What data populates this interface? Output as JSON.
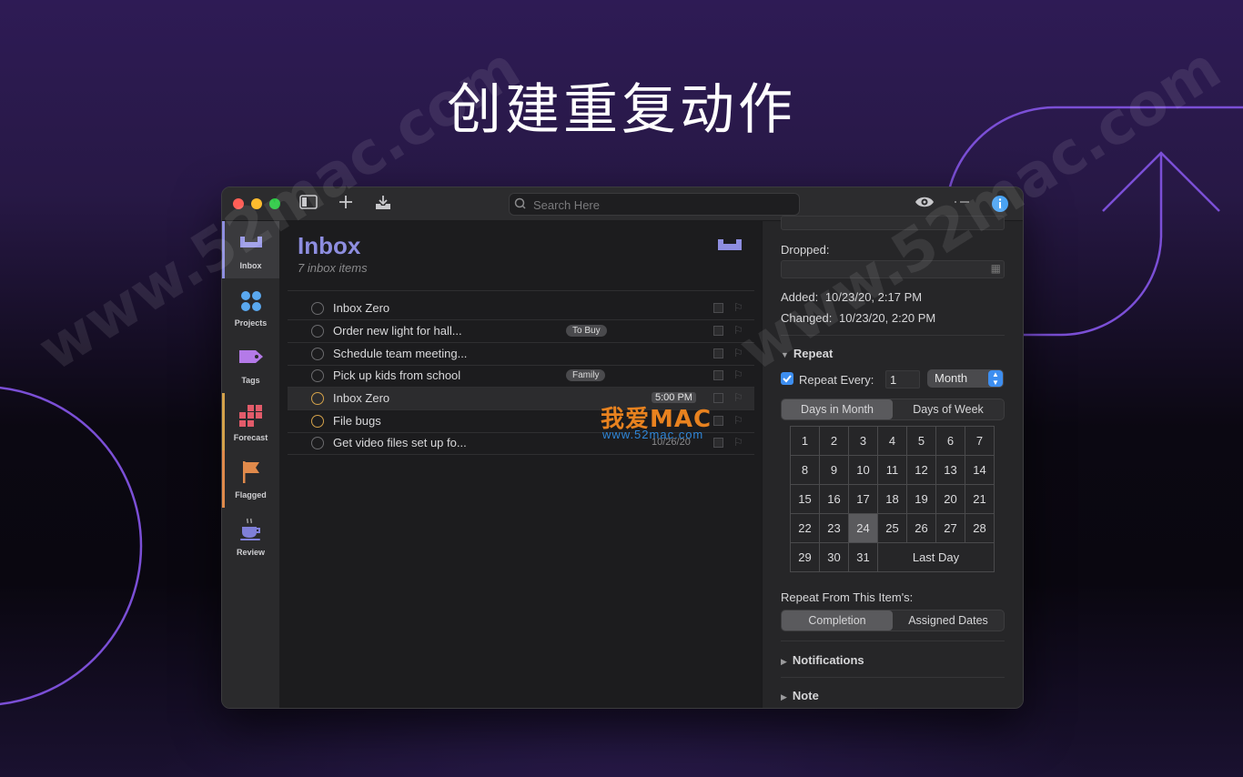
{
  "banner": {
    "title": "创建重复动作"
  },
  "watermark": {
    "left": "www.52mac.com",
    "right": "www.52mac.com",
    "center_brand": "我爱MAC",
    "center_url": "www.52mac.com"
  },
  "colors": {
    "accent_purple": "#7b4fd6",
    "sidebar_blue": "#8e8ee0",
    "forecast_red": "#e25b6a",
    "flagged_orange": "#e08a4b",
    "due_gold": "#d4a24a",
    "checkbox_blue": "#3d8ef0"
  },
  "toolbar": {
    "search_placeholder": "Search Here",
    "icons": [
      "sidebar-toggle-icon",
      "plus-icon",
      "inbox-download-icon",
      "eye-icon",
      "more-icon",
      "info-icon"
    ]
  },
  "sidebar": {
    "items": [
      {
        "label": "Inbox",
        "icon": "inbox-tray-icon"
      },
      {
        "label": "Projects",
        "icon": "projects-dots-icon"
      },
      {
        "label": "Tags",
        "icon": "tag-icon"
      },
      {
        "label": "Forecast",
        "icon": "forecast-grid-icon"
      },
      {
        "label": "Flagged",
        "icon": "flag-icon"
      },
      {
        "label": "Review",
        "icon": "coffee-cup-icon"
      }
    ]
  },
  "main": {
    "title": "Inbox",
    "subtitle": "7 inbox items",
    "rows": [
      {
        "title": "Inbox Zero",
        "tag": "",
        "date": ""
      },
      {
        "title": "Order new light for hall...",
        "tag": "To Buy",
        "date": ""
      },
      {
        "title": "Schedule team meeting...",
        "tag": "",
        "date": ""
      },
      {
        "title": "Pick up kids from school",
        "tag": "Family",
        "date": ""
      },
      {
        "title": "Inbox Zero",
        "tag": "",
        "date": "5:00 PM"
      },
      {
        "title": "File bugs",
        "tag": "",
        "date": ""
      },
      {
        "title": "Get video files set up fo...",
        "tag": "",
        "date": "10/26/20"
      }
    ]
  },
  "inspector": {
    "dropped_label": "Dropped:",
    "added_label": "Added:",
    "added_value": "10/23/20, 2:17 PM",
    "changed_label": "Changed:",
    "changed_value": "10/23/20, 2:20 PM",
    "repeat_header": "Repeat",
    "repeat_every_label": "Repeat Every:",
    "repeat_every_value": "1",
    "repeat_unit": "Month",
    "repeat_checked": true,
    "tabs": [
      "Days in Month",
      "Days of Week"
    ],
    "active_tab": "Days in Month",
    "calendar": {
      "days": [
        "1",
        "2",
        "3",
        "4",
        "5",
        "6",
        "7",
        "8",
        "9",
        "10",
        "11",
        "12",
        "13",
        "14",
        "15",
        "16",
        "17",
        "18",
        "19",
        "20",
        "21",
        "22",
        "23",
        "24",
        "25",
        "26",
        "27",
        "28",
        "29",
        "30",
        "31"
      ],
      "selected_day": "24",
      "last_day_label": "Last Day"
    },
    "repeat_from_label": "Repeat From This Item's:",
    "repeat_from_options": [
      "Completion",
      "Assigned Dates"
    ],
    "repeat_from_active": "Completion",
    "notifications_header": "Notifications",
    "note_header": "Note"
  }
}
